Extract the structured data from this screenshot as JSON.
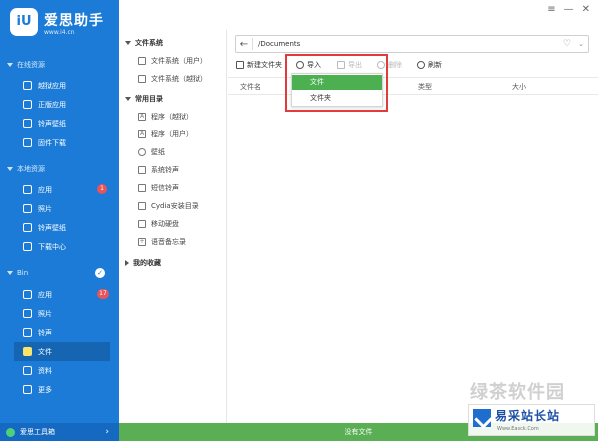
{
  "app": {
    "logo_text": "iU",
    "name": "爱思助手",
    "url": "www.i4.cn"
  },
  "window_controls": {
    "menu": "≡",
    "minimize": "—",
    "close": "✕"
  },
  "sidebar": {
    "sections": [
      {
        "title": "在线资源",
        "items": [
          {
            "label": "越狱应用"
          },
          {
            "label": "正版应用"
          },
          {
            "label": "铃声壁纸"
          },
          {
            "label": "固件下载"
          }
        ]
      },
      {
        "title": "本地资源",
        "items": [
          {
            "label": "应用",
            "badge": "1"
          },
          {
            "label": "照片"
          },
          {
            "label": "铃声壁纸"
          },
          {
            "label": "下载中心"
          }
        ]
      },
      {
        "title": "Bin",
        "items": [
          {
            "label": "应用",
            "badge": "17"
          },
          {
            "label": "照片"
          },
          {
            "label": "铃声"
          },
          {
            "label": "文件",
            "active": true
          },
          {
            "label": "资料"
          },
          {
            "label": "更多"
          }
        ]
      }
    ],
    "bottom_label": "爱思工具箱"
  },
  "tree": {
    "groups": [
      {
        "title": "文件系统",
        "items": [
          "文件系统（用户）",
          "文件系统（越狱）"
        ]
      },
      {
        "title": "常用目录",
        "items": [
          "程序（越狱）",
          "程序（用户）",
          "壁纸",
          "系统铃声",
          "短信铃声",
          "Cydia安装目录",
          "移动硬盘",
          "语音备忘录"
        ]
      },
      {
        "title": "我的收藏",
        "items": []
      }
    ]
  },
  "pathbar": {
    "path": "/Documents"
  },
  "toolbar": {
    "new_folder": "新建文件夹",
    "import": "导入",
    "export": "导出",
    "delete": "删除",
    "refresh": "刷新"
  },
  "import_menu": {
    "items": [
      "文件",
      "文件夹"
    ],
    "active_index": 0
  },
  "table": {
    "columns": [
      "文件名",
      "类型",
      "大小"
    ]
  },
  "status": {
    "text": "没有文件"
  },
  "watermark": {
    "big": "绿茶软件园",
    "name": "易采站长站",
    "sub": "Www.Easck.Com"
  },
  "colors": {
    "sidebar": "#1b7bd6",
    "sidebar_active": "#1565b3",
    "status": "#5aae53",
    "menu_active": "#4caf50",
    "highlight_border": "#e23b3b",
    "badge": "#e7545a"
  }
}
